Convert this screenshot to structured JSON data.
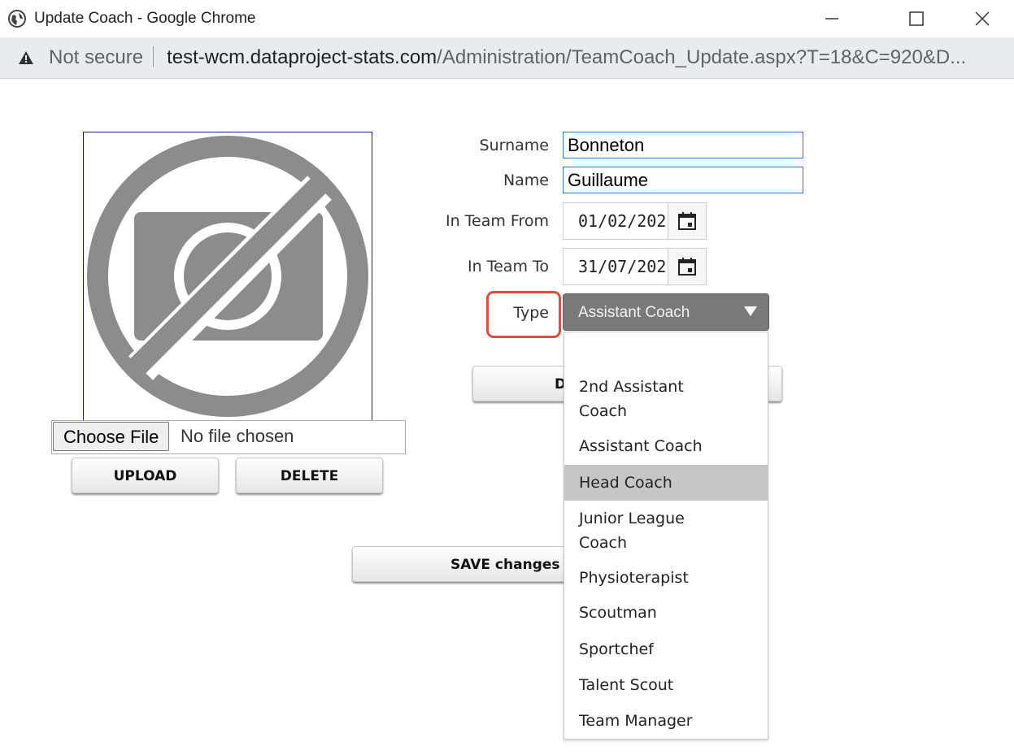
{
  "window": {
    "title": "Update Coach - Google Chrome",
    "security_label": "Not secure",
    "url_host": "test-wcm.dataproject-stats.com",
    "url_path": "/Administration/TeamCoach_Update.aspx?T=18&C=920&D..."
  },
  "photo": {
    "icon": "no-photo-icon"
  },
  "file_input": {
    "button_label": "Choose File",
    "status": "No file chosen"
  },
  "buttons": {
    "upload": "UPLOAD",
    "delete": "DELETE",
    "delete_partial": "D",
    "save": "SAVE changes"
  },
  "form": {
    "surname_label": "Surname",
    "surname_value": "Bonneton",
    "name_label": "Name",
    "name_value": "Guillaume",
    "from_label": "In Team From",
    "from_value": "01/02/202",
    "to_label": "In Team To",
    "to_value": "31/07/202",
    "type_label": "Type",
    "type_value": "Assistant Coach"
  },
  "type_options": [
    "",
    "2nd Assistant Coach",
    "Assistant Coach",
    "Head Coach",
    "Junior League Coach",
    "Physioterapist",
    "Scoutman",
    "Sportchef",
    "Talent Scout",
    "Team Manager"
  ],
  "highlighted_option": "Head Coach",
  "colors": {
    "highlight_box": "#d9503f",
    "input_border": "#2e7bd3",
    "select_bg": "#7a7a7a"
  }
}
